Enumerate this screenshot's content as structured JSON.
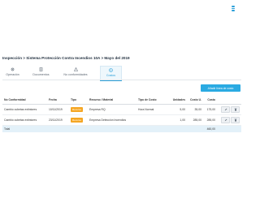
{
  "header": {
    "title": "Inspección > Sistema Protección Contra Incendios 10A > Mayo del 2019"
  },
  "tabs": [
    {
      "label": "Operación",
      "icon": "gear-icon",
      "active": false
    },
    {
      "label": "Documentos",
      "icon": "document-icon",
      "active": false
    },
    {
      "label": "No conformidades",
      "icon": "warning-icon",
      "active": false
    },
    {
      "label": "Costos",
      "icon": "dollar-icon",
      "active": true
    }
  ],
  "toolbar": {
    "add_label": "Añadir línea de costo"
  },
  "table": {
    "columns": [
      "No Conformidad",
      "Fecha",
      "Tipo",
      "Recurso / Material",
      "Tipo de Costo",
      "Unidades",
      "Costo U.",
      "Costo"
    ],
    "rows": [
      {
        "nc": "Cambio cubetas extintores",
        "fecha": "10/11/2019",
        "tipo": "Recurso",
        "recurso": "Empresa RQ",
        "tipo_costo": "Hora Normal",
        "unidades": "5,00",
        "costo_u": "35,00",
        "costo": "175,00"
      },
      {
        "nc": "Cambio cubetas extintores",
        "fecha": "23/11/2019",
        "tipo": "Recurso",
        "recurso": "Empresa Detección Incendios",
        "tipo_costo": "",
        "unidades": "1,00",
        "costo_u": "285,00",
        "costo": "285,00"
      }
    ],
    "total_label": "Total",
    "total_value": "460,00"
  },
  "colors": {
    "accent": "#2aaae2",
    "badge": "#f5a623",
    "total_row": "#e3f1f9"
  }
}
